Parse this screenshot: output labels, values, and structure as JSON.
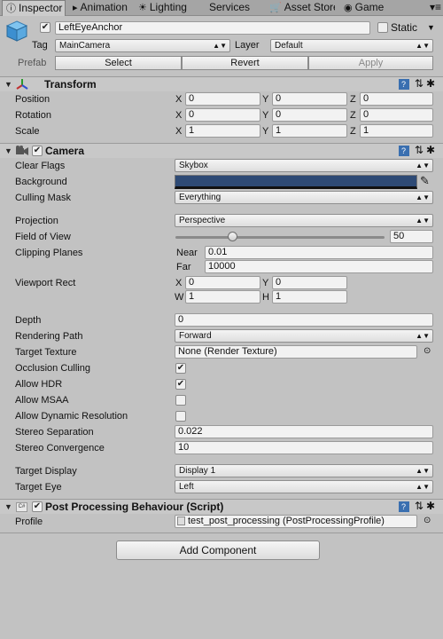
{
  "tabs": [
    {
      "label": "Inspector",
      "icon": "info-icon",
      "active": true
    },
    {
      "label": "Animation",
      "icon": "animation-icon"
    },
    {
      "label": "Lighting",
      "icon": "lighting-icon"
    },
    {
      "label": "Services",
      "icon": ""
    },
    {
      "label": "Asset Store",
      "icon": "store-icon"
    },
    {
      "label": "Game",
      "icon": "game-icon"
    }
  ],
  "object": {
    "active": true,
    "name": "LeftEyeAnchor",
    "static_label": "Static",
    "static_checked": false,
    "tag_label": "Tag",
    "tag_value": "MainCamera",
    "layer_label": "Layer",
    "layer_value": "Default",
    "prefab_label": "Prefab",
    "prefab_select": "Select",
    "prefab_revert": "Revert",
    "prefab_apply": "Apply"
  },
  "transform": {
    "title": "Transform",
    "position_label": "Position",
    "rotation_label": "Rotation",
    "scale_label": "Scale",
    "position": {
      "x": "0",
      "y": "0",
      "z": "0"
    },
    "rotation": {
      "x": "0",
      "y": "0",
      "z": "0"
    },
    "scale": {
      "x": "1",
      "y": "1",
      "z": "1"
    },
    "axis_x": "X",
    "axis_y": "Y",
    "axis_z": "Z"
  },
  "camera": {
    "title": "Camera",
    "enabled": true,
    "clear_flags_label": "Clear Flags",
    "clear_flags": "Skybox",
    "background_label": "Background",
    "background_color": "#2e4a75",
    "culling_mask_label": "Culling Mask",
    "culling_mask": "Everything",
    "projection_label": "Projection",
    "projection": "Perspective",
    "fov_label": "Field of View",
    "fov": "50",
    "fov_slider_fraction": 0.27,
    "clipping_label": "Clipping Planes",
    "near_label": "Near",
    "near": "0.01",
    "far_label": "Far",
    "far": "10000",
    "viewport_label": "Viewport Rect",
    "vp_x_label": "X",
    "vp_x": "0",
    "vp_y_label": "Y",
    "vp_y": "0",
    "vp_w_label": "W",
    "vp_w": "1",
    "vp_h_label": "H",
    "vp_h": "1",
    "depth_label": "Depth",
    "depth": "0",
    "rendering_path_label": "Rendering Path",
    "rendering_path": "Forward",
    "target_texture_label": "Target Texture",
    "target_texture": "None (Render Texture)",
    "occlusion_label": "Occlusion Culling",
    "occlusion": true,
    "hdr_label": "Allow HDR",
    "hdr": true,
    "msaa_label": "Allow MSAA",
    "msaa": false,
    "dynres_label": "Allow Dynamic Resolution",
    "dynres": false,
    "stereo_sep_label": "Stereo Separation",
    "stereo_sep": "0.022",
    "stereo_conv_label": "Stereo Convergence",
    "stereo_conv": "10",
    "target_display_label": "Target Display",
    "target_display": "Display 1",
    "target_eye_label": "Target Eye",
    "target_eye": "Left"
  },
  "ppb": {
    "title": "Post Processing Behaviour (Script)",
    "enabled": true,
    "profile_label": "Profile",
    "profile": "test_post_processing (PostProcessingProfile)"
  },
  "add_component": "Add Component",
  "colors": {
    "panel": "#c2c2c2",
    "header": "#c8c8c8",
    "tab_active": "#cbcbcb",
    "accent": "#3a6fb0"
  }
}
